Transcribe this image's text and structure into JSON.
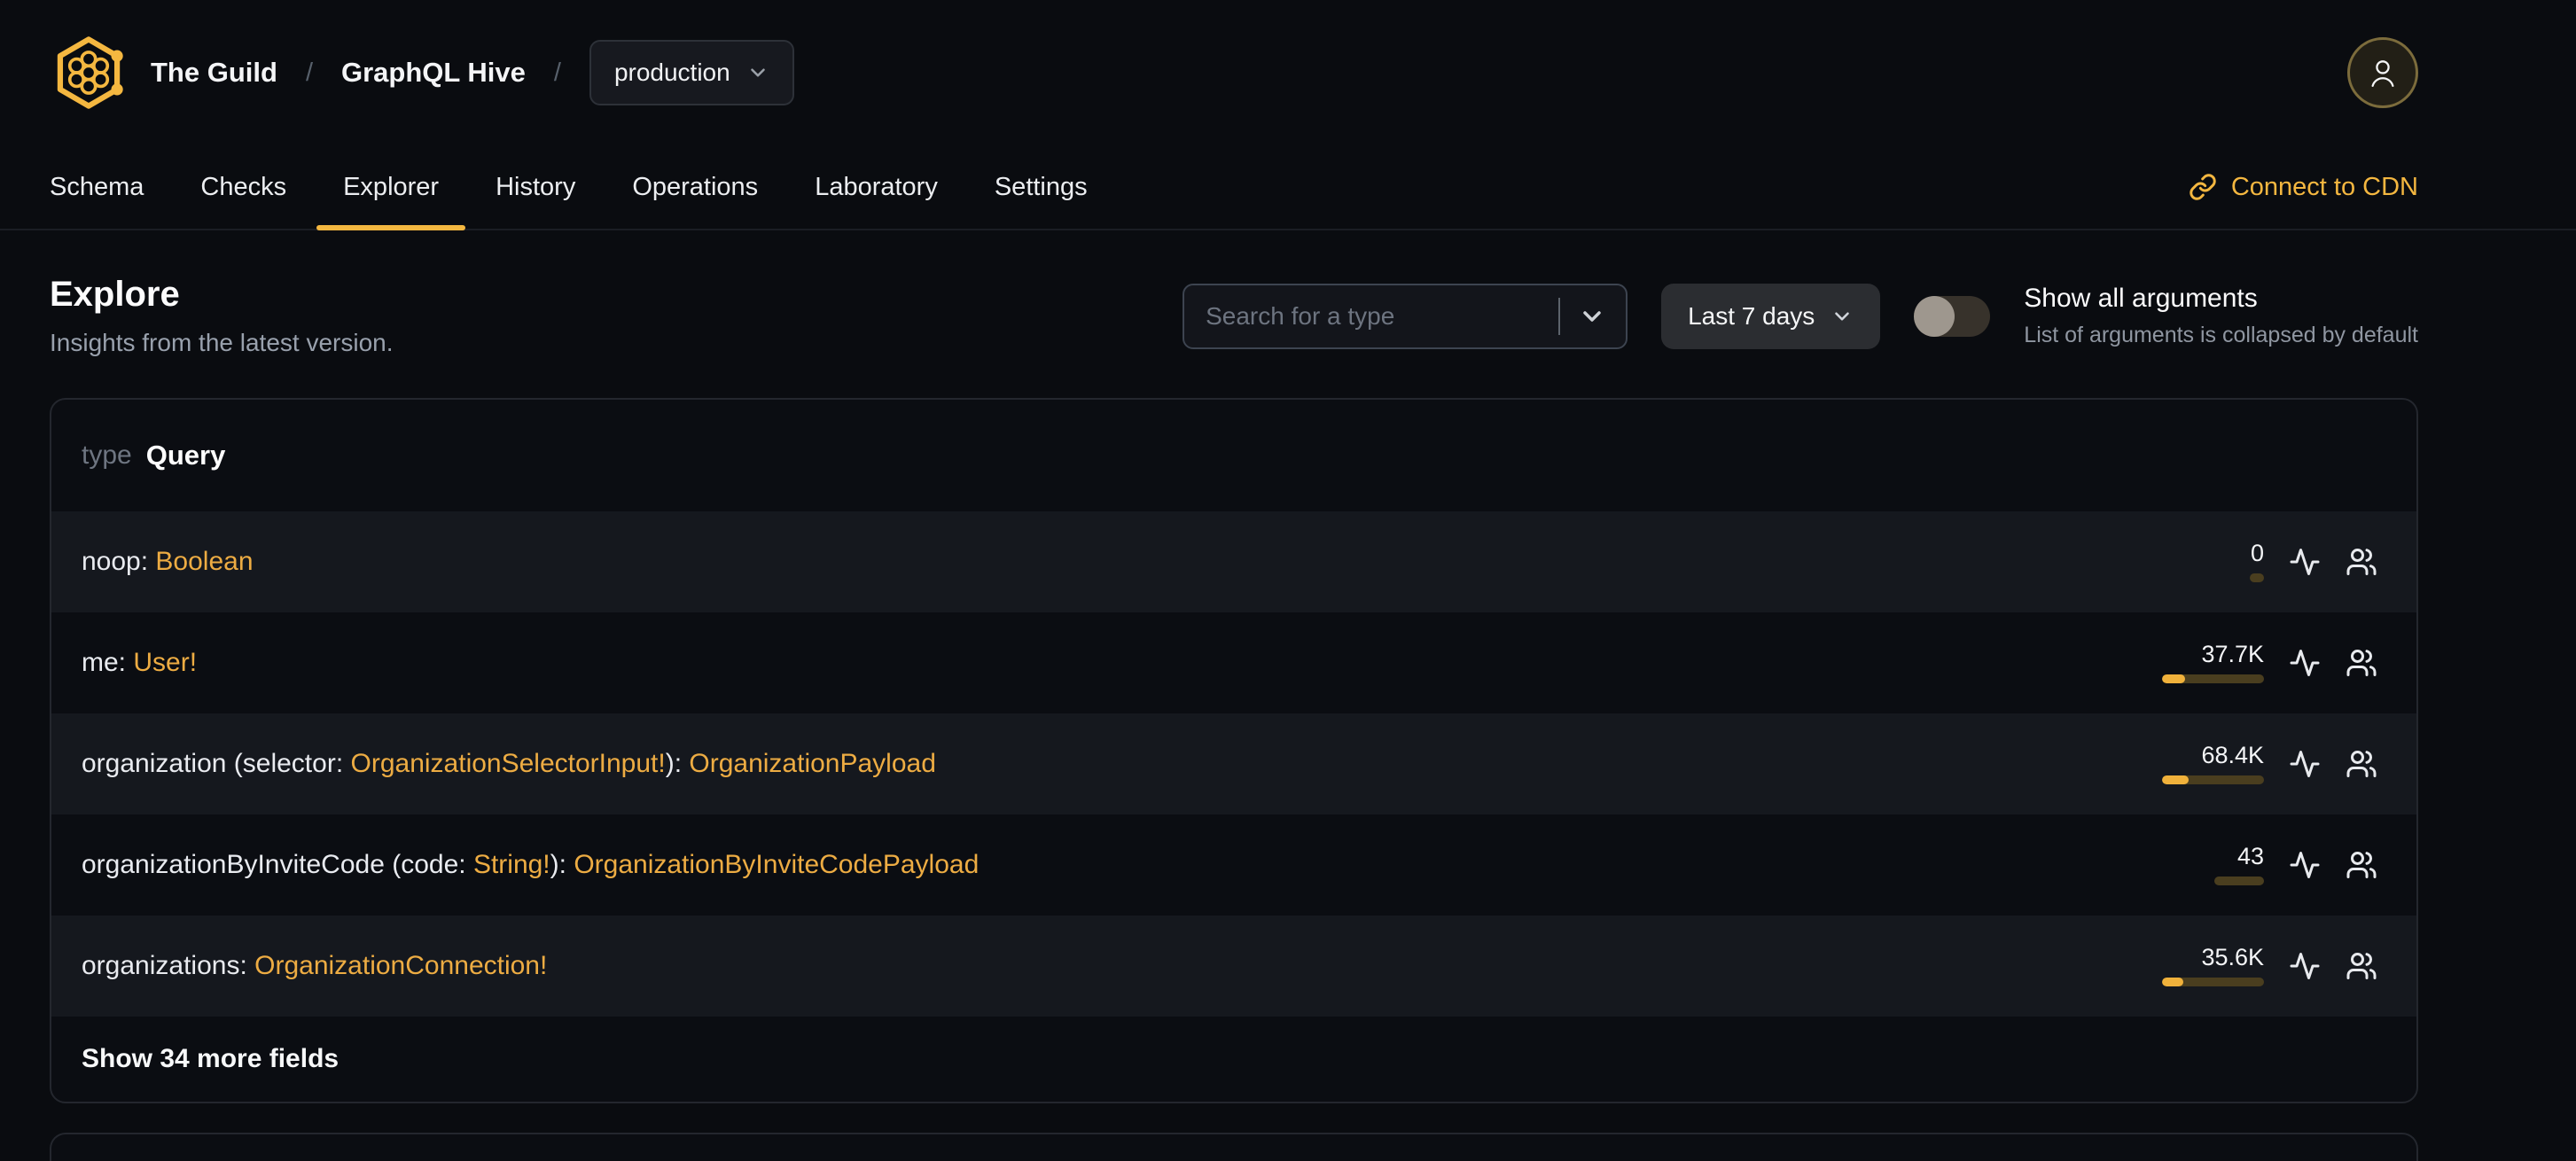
{
  "header": {
    "breadcrumb": {
      "org": "The Guild",
      "separator": "/",
      "project": "GraphQL Hive",
      "target": "production"
    }
  },
  "nav": {
    "tabs": [
      {
        "label": "Schema",
        "active": false
      },
      {
        "label": "Checks",
        "active": false
      },
      {
        "label": "Explorer",
        "active": true
      },
      {
        "label": "History",
        "active": false
      },
      {
        "label": "Operations",
        "active": false
      },
      {
        "label": "Laboratory",
        "active": false
      },
      {
        "label": "Settings",
        "active": false
      }
    ],
    "cdn_link_label": "Connect to CDN"
  },
  "page": {
    "title": "Explore",
    "subtitle": "Insights from the latest version."
  },
  "controls": {
    "search_placeholder": "Search for a type",
    "period_label": "Last 7 days",
    "toggle_label": "Show all arguments",
    "toggle_description": "List of arguments is collapsed by default",
    "toggle_state": "off"
  },
  "colors": {
    "accent": "#f4b740",
    "type_link": "#edac43",
    "bar_fill": "#f0b13b",
    "bar_track": "#4a3e1f",
    "active_tab_underline": "#f4b740"
  },
  "card": {
    "kind_label": "type",
    "type_name": "Query",
    "fields": [
      {
        "segments": [
          {
            "text": "noop: ",
            "is_type": false
          },
          {
            "text": "Boolean",
            "is_type": true
          }
        ],
        "value": "0",
        "bar": {
          "track_w": 16,
          "fill_w": 0
        }
      },
      {
        "segments": [
          {
            "text": "me: ",
            "is_type": false
          },
          {
            "text": "User!",
            "is_type": true
          }
        ],
        "value": "37.7K",
        "bar": {
          "track_w": 115,
          "fill_w": 26
        }
      },
      {
        "segments": [
          {
            "text": "organization (selector: ",
            "is_type": false
          },
          {
            "text": "OrganizationSelectorInput!",
            "is_type": true
          },
          {
            "text": "): ",
            "is_type": false
          },
          {
            "text": "OrganizationPayload",
            "is_type": true
          }
        ],
        "value": "68.4K",
        "bar": {
          "track_w": 115,
          "fill_w": 30
        }
      },
      {
        "segments": [
          {
            "text": "organizationByInviteCode (code: ",
            "is_type": false
          },
          {
            "text": "String!",
            "is_type": true
          },
          {
            "text": "): ",
            "is_type": false
          },
          {
            "text": "OrganizationByInviteCodePayload",
            "is_type": true
          }
        ],
        "value": "43",
        "bar": {
          "track_w": 56,
          "fill_w": 0
        }
      },
      {
        "segments": [
          {
            "text": "organizations: ",
            "is_type": false
          },
          {
            "text": "OrganizationConnection!",
            "is_type": true
          }
        ],
        "value": "35.6K",
        "bar": {
          "track_w": 115,
          "fill_w": 24
        }
      }
    ],
    "show_more_label": "Show 34 more fields"
  }
}
